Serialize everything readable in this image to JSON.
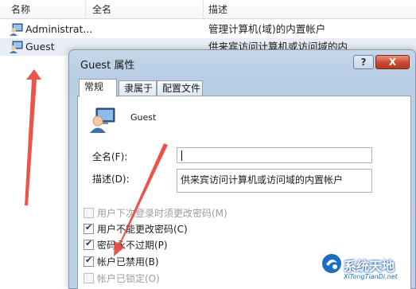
{
  "list": {
    "columns": [
      "名称",
      "全名",
      "描述"
    ],
    "rows": [
      {
        "name": "Administrat...",
        "full_name": "",
        "description": "管理计算机(域)的内置帐户"
      },
      {
        "name": "Guest",
        "full_name": "",
        "description": "供来宾访问计算机或访问域的内"
      }
    ]
  },
  "dialog": {
    "title": "Guest 属性",
    "help_label": "?",
    "close_label": "X",
    "tabs": [
      {
        "label": "常规",
        "active": true
      },
      {
        "label": "隶属于",
        "active": false
      },
      {
        "label": "配置文件",
        "active": false
      }
    ],
    "user_name": "Guest",
    "full_name_label": "全名(F):",
    "full_name_value": "",
    "description_label": "描述(D):",
    "description_value": "供来宾访问计算机或访问域的内置帐户",
    "checkboxes": [
      {
        "label": "用户下次登录时须更改密码(M)",
        "checked": false,
        "enabled": false
      },
      {
        "label": "用户不能更改密码(C)",
        "checked": true,
        "enabled": true
      },
      {
        "label": "密码永不过期(P)",
        "checked": true,
        "enabled": true
      },
      {
        "label": "帐户已禁用(B)",
        "checked": true,
        "enabled": true
      },
      {
        "label": "帐户已锁定(O)",
        "checked": false,
        "enabled": false
      }
    ]
  },
  "watermark": {
    "title": "系统天地",
    "url": "XiTongTianDi.net"
  },
  "colors": {
    "annotation_arrow": "#e8453c",
    "dialog_frame": "#bdd0e6",
    "close_button": "#c8492f"
  }
}
